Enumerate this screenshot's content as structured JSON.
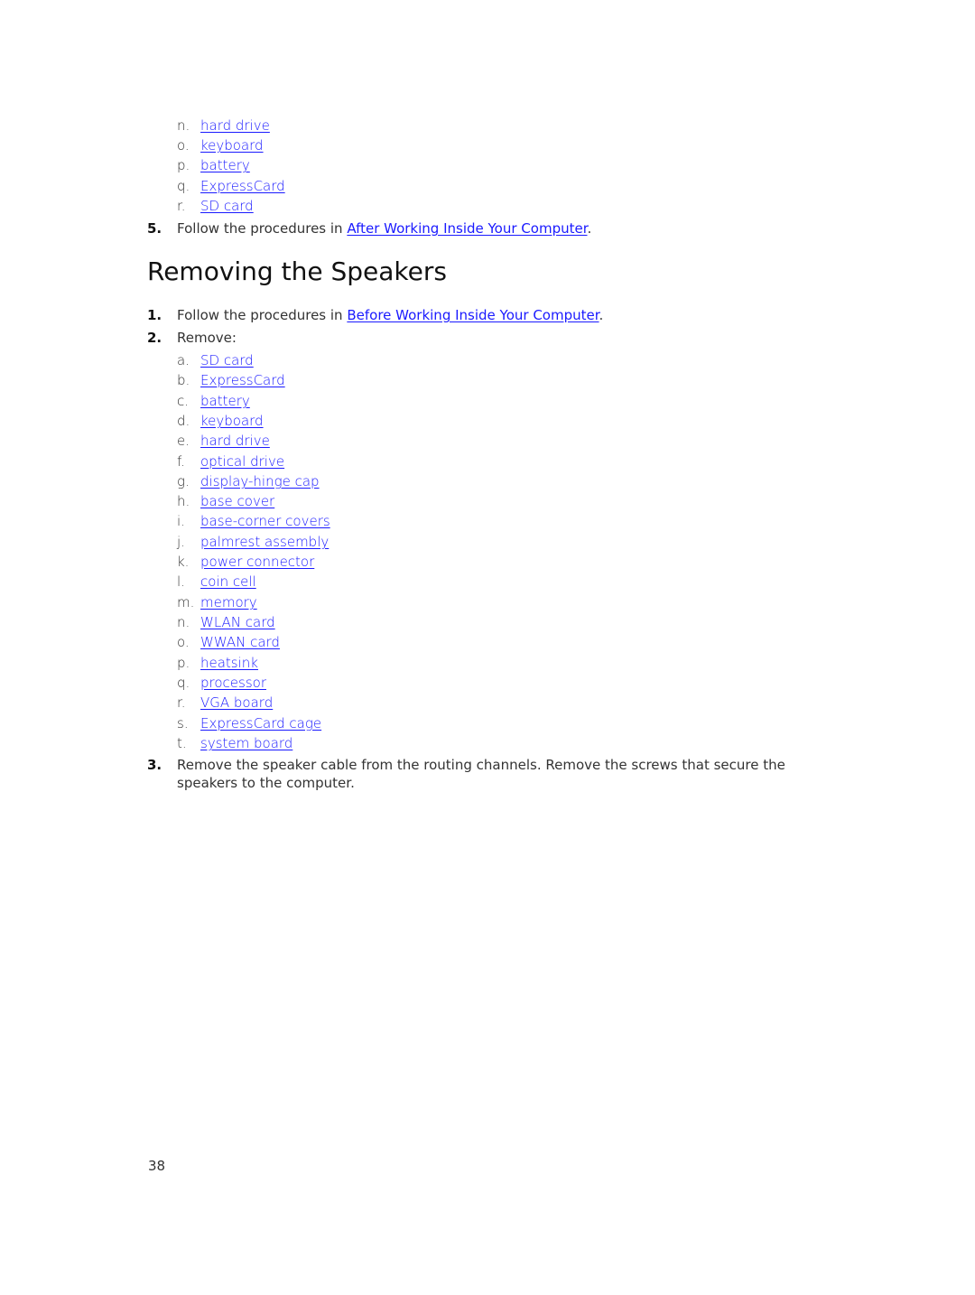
{
  "prev_list": {
    "items": [
      {
        "letter": "n.",
        "label": "hard drive"
      },
      {
        "letter": "o.",
        "label": "keyboard"
      },
      {
        "letter": "p.",
        "label": "battery"
      },
      {
        "letter": "q.",
        "label": "ExpressCard"
      },
      {
        "letter": "r.",
        "label": "SD card"
      }
    ]
  },
  "prev_step5": {
    "number": "5.",
    "text": "Follow the procedures in ",
    "link": "After Working Inside Your Computer",
    "suffix": "."
  },
  "section": {
    "title": "Removing the Speakers",
    "step1": {
      "number": "1.",
      "text": "Follow the procedures in ",
      "link": "Before Working Inside Your Computer",
      "suffix": "."
    },
    "step2": {
      "number": "2.",
      "text": "Remove:",
      "items": [
        {
          "letter": "a.",
          "label": "SD card"
        },
        {
          "letter": "b.",
          "label": "ExpressCard"
        },
        {
          "letter": "c.",
          "label": "battery"
        },
        {
          "letter": "d.",
          "label": "keyboard"
        },
        {
          "letter": "e.",
          "label": "hard drive"
        },
        {
          "letter": "f.",
          "label": "optical drive"
        },
        {
          "letter": "g.",
          "label": "display-hinge cap"
        },
        {
          "letter": "h.",
          "label": "base cover"
        },
        {
          "letter": "i.",
          "label": "base-corner covers"
        },
        {
          "letter": "j.",
          "label": "palmrest assembly"
        },
        {
          "letter": "k.",
          "label": "power connector"
        },
        {
          "letter": "l.",
          "label": "coin cell"
        },
        {
          "letter": "m.",
          "label": "memory"
        },
        {
          "letter": "n.",
          "label": "WLAN card"
        },
        {
          "letter": "o.",
          "label": "WWAN card"
        },
        {
          "letter": "p.",
          "label": "heatsink"
        },
        {
          "letter": "q.",
          "label": "processor"
        },
        {
          "letter": "r.",
          "label": "VGA board"
        },
        {
          "letter": "s.",
          "label": "ExpressCard cage"
        },
        {
          "letter": "t.",
          "label": "system board"
        }
      ]
    },
    "step3": {
      "number": "3.",
      "text": "Remove the speaker cable from the routing channels. Remove the screws that secure the speakers to the computer."
    }
  },
  "footer": {
    "page_number": "38"
  },
  "colors": {
    "link": "#1a1aff",
    "text": "#222222"
  }
}
